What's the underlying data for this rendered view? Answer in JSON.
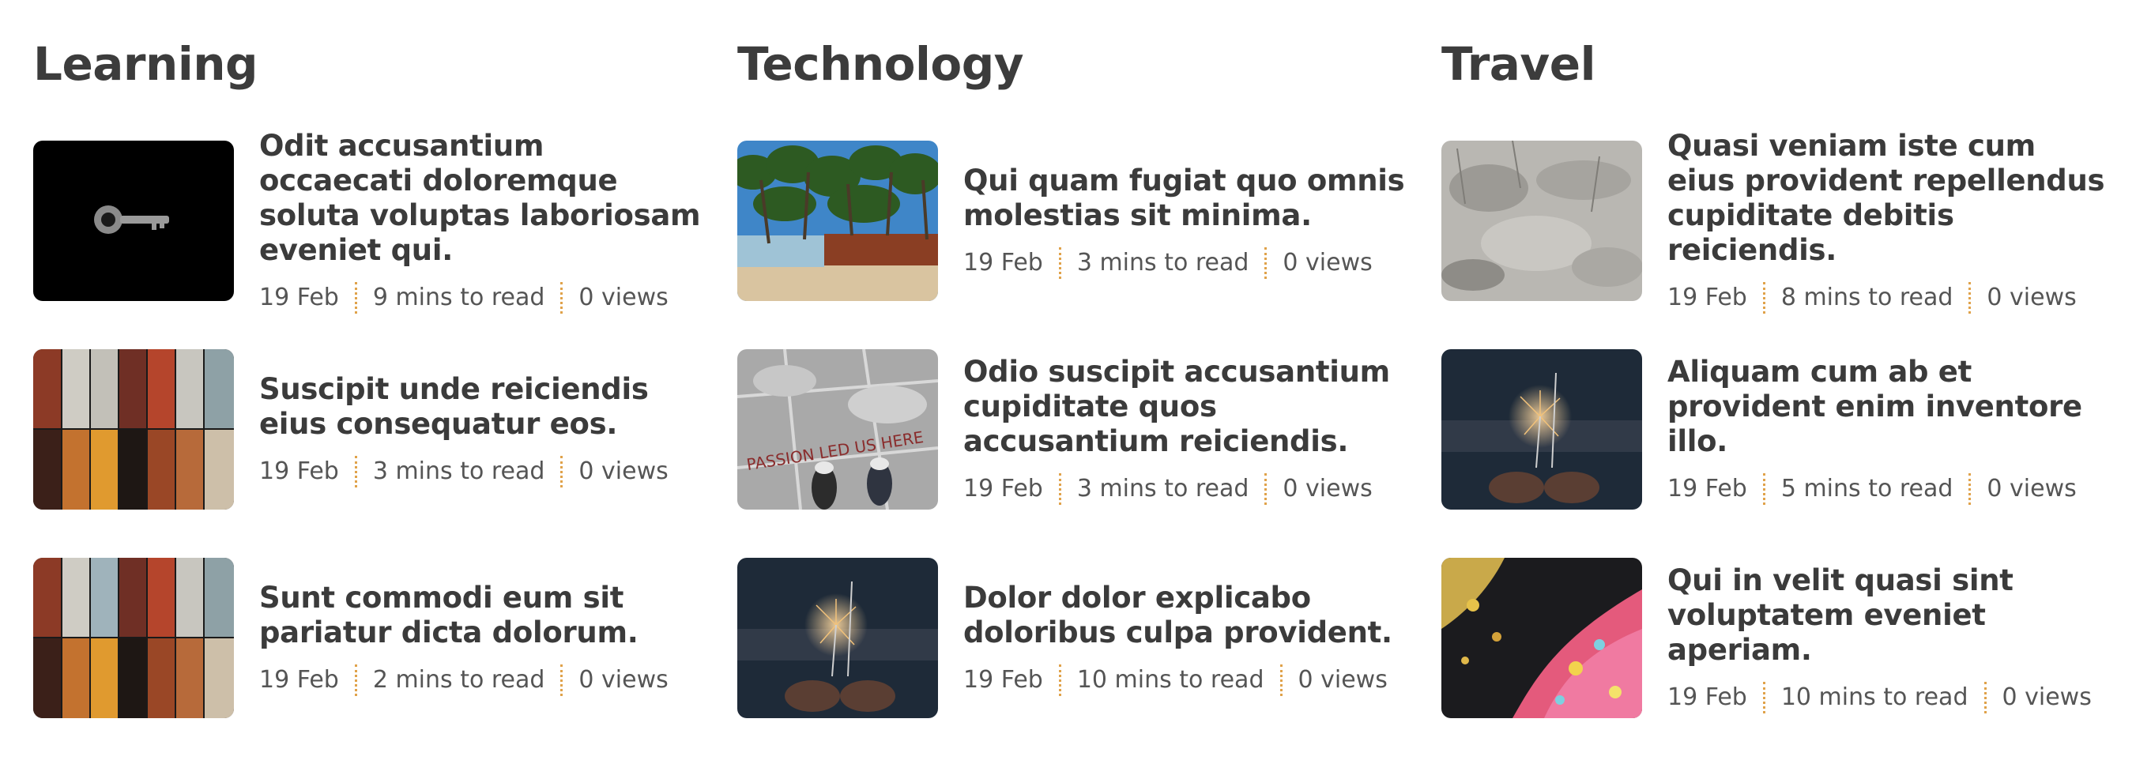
{
  "sections": [
    {
      "title": "Learning",
      "posts": [
        {
          "title": "Odit accusantium occaecati doloremque soluta voluptas laboriosam eveniet qui.",
          "date": "19 Feb",
          "read": "9 mins to read",
          "views": "0 views",
          "image": "key-image"
        },
        {
          "title": "Suscipit unde reiciendis eius consequatur eos.",
          "date": "19 Feb",
          "read": "3 mins to read",
          "views": "0 views",
          "image": "lockers-image"
        },
        {
          "title": "Sunt commodi eum sit pariatur dicta dolorum.",
          "date": "19 Feb",
          "read": "2 mins to read",
          "views": "0 views",
          "image": "lockers-image"
        }
      ]
    },
    {
      "title": "Technology",
      "posts": [
        {
          "title": "Qui quam fugiat quo omnis molestias sit minima.",
          "date": "19 Feb",
          "read": "3 mins to read",
          "views": "0 views",
          "image": "palm-beach-image"
        },
        {
          "title": "Odio suscipit accusantium cupiditate quos accusantium reiciendis.",
          "date": "19 Feb",
          "read": "3 mins to read",
          "views": "0 views",
          "image": "passion-floor-image"
        },
        {
          "title": "Dolor dolor explicabo doloribus culpa provident.",
          "date": "19 Feb",
          "read": "10 mins to read",
          "views": "0 views",
          "image": "sparklers-image"
        }
      ]
    },
    {
      "title": "Travel",
      "posts": [
        {
          "title": "Quasi veniam iste cum eius provident repellendus cupiditate debitis reiciendis.",
          "date": "19 Feb",
          "read": "8 mins to read",
          "views": "0 views",
          "image": "concrete-wall-image"
        },
        {
          "title": "Aliquam cum ab et provident enim inventore illo.",
          "date": "19 Feb",
          "read": "5 mins to read",
          "views": "0 views",
          "image": "sparklers-image"
        },
        {
          "title": "Qui in velit quasi sint voluptatem eveniet aperiam.",
          "date": "19 Feb",
          "read": "10 mins to read",
          "views": "0 views",
          "image": "fluid-art-image"
        }
      ]
    }
  ],
  "image_text": {
    "passion_floor": "PASSION LED US HERE"
  },
  "colors": {
    "heading": "#3c3c3c",
    "meta_text": "#555555",
    "separator": "#e0a24a"
  }
}
